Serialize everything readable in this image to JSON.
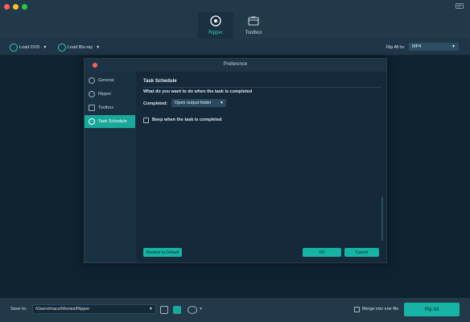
{
  "header": {
    "tabs": [
      {
        "label": "Ripper",
        "icon": "disc-icon",
        "active": true
      },
      {
        "label": "Toolbox",
        "icon": "toolbox-icon",
        "active": false
      }
    ]
  },
  "toolbar": {
    "load_dvd_label": "Load DVD",
    "load_bluray_label": "Load Blu-ray",
    "rip_all_to_label": "Rip All to:",
    "rip_all_to_value": "MP4"
  },
  "dialog": {
    "title": "Preference",
    "sidebar": [
      {
        "label": "General",
        "icon": "gear-icon"
      },
      {
        "label": "Ripper",
        "icon": "ripper-icon"
      },
      {
        "label": "Toolbox",
        "icon": "toolbox-icon"
      },
      {
        "label": "Task Schedule",
        "icon": "clock-icon"
      }
    ],
    "section_title": "Task Schedule",
    "question": "What do you want to do when the task is completed",
    "completed_label": "Completed:",
    "completed_value": "Open output folder",
    "beep_label": "Beep when the task is completed",
    "beep_checked": false,
    "restore_label": "Restore to Default",
    "ok_label": "OK",
    "cancel_label": "Cancel"
  },
  "bottom": {
    "save_to_label": "Save to:",
    "save_path": "/Users/macz/Movies/Ripper",
    "merge_label": "Merge into one file",
    "merge_checked": false,
    "rip_all_label": "Rip All"
  },
  "colors": {
    "accent": "#19a89a",
    "background": "#1b3040",
    "dialog_bg": "#15293a"
  }
}
